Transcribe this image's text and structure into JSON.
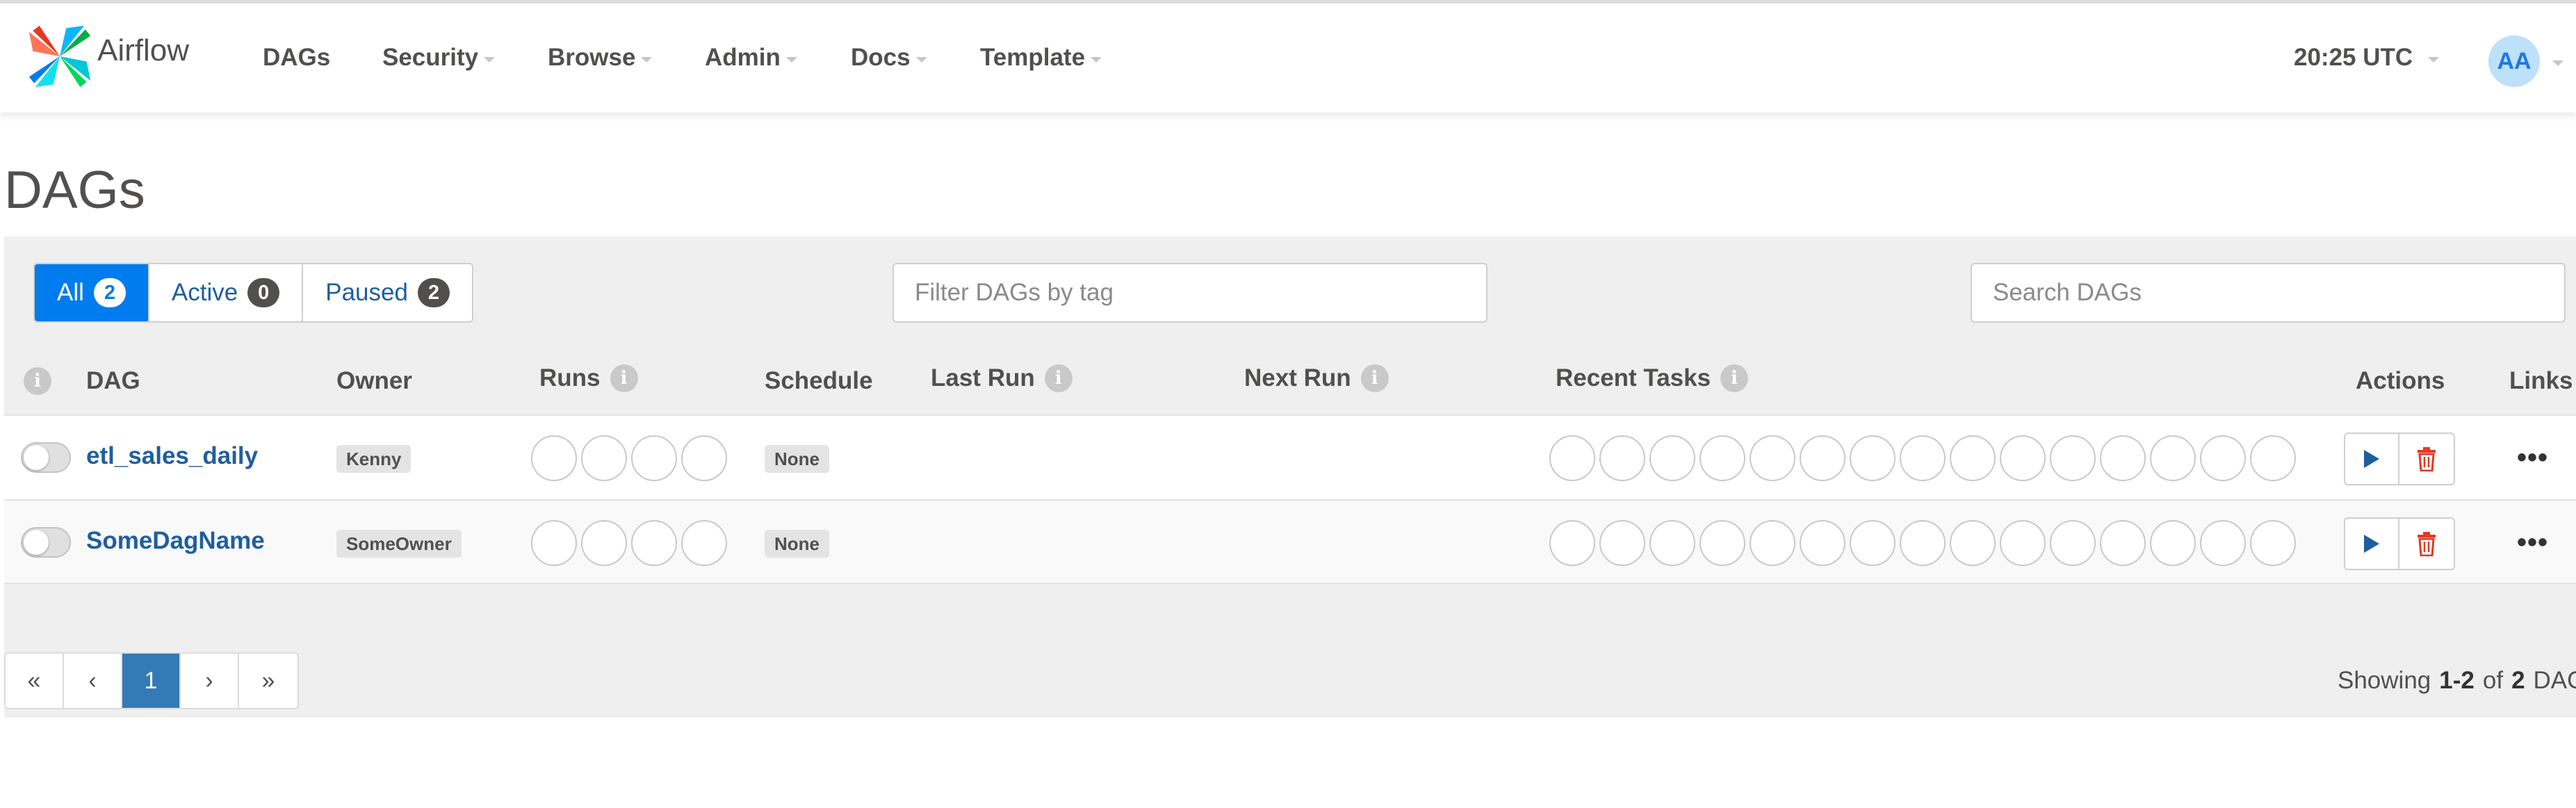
{
  "navbar": {
    "brand": "Airflow",
    "menu": [
      {
        "label": "DAGs",
        "has_caret": false
      },
      {
        "label": "Security",
        "has_caret": true
      },
      {
        "label": "Browse",
        "has_caret": true
      },
      {
        "label": "Admin",
        "has_caret": true
      },
      {
        "label": "Docs",
        "has_caret": true
      },
      {
        "label": "Template",
        "has_caret": true
      }
    ],
    "time": "20:25 UTC",
    "avatar": "AA"
  },
  "page": {
    "title": "DAGs"
  },
  "filters": {
    "status": [
      {
        "label": "All",
        "count": "2",
        "active": true
      },
      {
        "label": "Active",
        "count": "0",
        "active": false
      },
      {
        "label": "Paused",
        "count": "2",
        "active": false
      }
    ],
    "tag_placeholder": "Filter DAGs by tag",
    "search_placeholder": "Search DAGs"
  },
  "table": {
    "headers": {
      "dag": "DAG",
      "owner": "Owner",
      "runs": "Runs",
      "schedule": "Schedule",
      "last_run": "Last Run",
      "next_run": "Next Run",
      "recent_tasks": "Recent Tasks",
      "actions": "Actions",
      "links": "Links"
    },
    "rows": [
      {
        "dag_id": "etl_sales_daily",
        "owner": "Kenny",
        "schedule": "None",
        "paused": true,
        "runs_circles": 4,
        "task_circles": 15
      },
      {
        "dag_id": "SomeDagName",
        "owner": "SomeOwner",
        "schedule": "None",
        "paused": true,
        "runs_circles": 4,
        "task_circles": 15
      }
    ],
    "more_label": "•••"
  },
  "pagination": {
    "first": "«",
    "prev": "‹",
    "current": "1",
    "next": "›",
    "last": "»",
    "showing_prefix": "Showing",
    "showing_range": "1-2",
    "showing_of": "of",
    "showing_total": "2",
    "showing_suffix": "DAGs"
  },
  "colors": {
    "primary": "#017cee",
    "link": "#1f5e9e",
    "pager_active": "#337ab7",
    "delete": "#e43921"
  },
  "icons": {
    "trigger": "play-icon",
    "delete": "trash-icon",
    "info": "info-icon",
    "logo": "airflow-pinwheel-logo"
  }
}
